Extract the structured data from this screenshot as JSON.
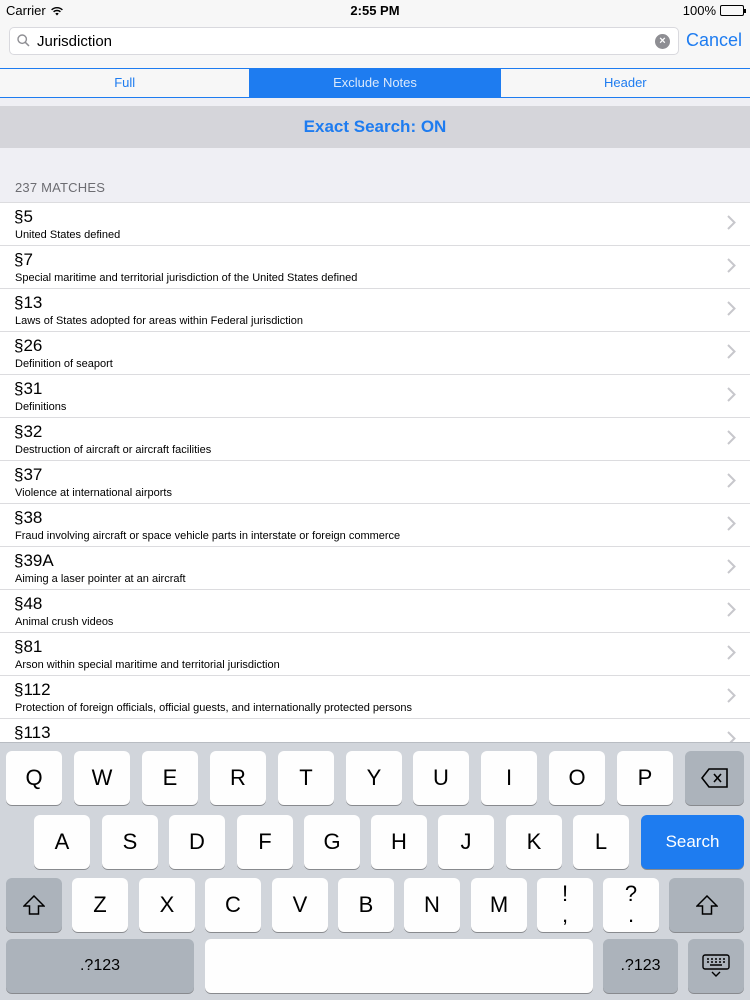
{
  "status": {
    "carrier": "Carrier",
    "time": "2:55 PM",
    "battery": "100%"
  },
  "search": {
    "query": "Jurisdiction",
    "cancel_label": "Cancel"
  },
  "segments": [
    {
      "label": "Full",
      "active": false
    },
    {
      "label": "Exclude Notes",
      "active": true
    },
    {
      "label": "Header",
      "active": false
    }
  ],
  "exact_search": "Exact Search: ON",
  "matches_label": "237 MATCHES",
  "results": [
    {
      "section": "§5",
      "title": "United States defined"
    },
    {
      "section": "§7",
      "title": "Special maritime and territorial jurisdiction of the United States defined"
    },
    {
      "section": "§13",
      "title": "Laws of States adopted for areas within Federal jurisdiction"
    },
    {
      "section": "§26",
      "title": "Definition of seaport"
    },
    {
      "section": "§31",
      "title": "Definitions"
    },
    {
      "section": "§32",
      "title": "Destruction of aircraft or aircraft facilities"
    },
    {
      "section": "§37",
      "title": "Violence at international airports"
    },
    {
      "section": "§38",
      "title": "Fraud involving aircraft or space vehicle parts in interstate or foreign commerce"
    },
    {
      "section": "§39A",
      "title": "Aiming a laser pointer at an aircraft"
    },
    {
      "section": "§48",
      "title": "Animal crush videos"
    },
    {
      "section": "§81",
      "title": "Arson within special maritime and territorial jurisdiction"
    },
    {
      "section": "§112",
      "title": "Protection of foreign officials, official guests, and internationally protected persons"
    },
    {
      "section": "§113",
      "title": ""
    }
  ],
  "keyboard": {
    "row1": [
      "Q",
      "W",
      "E",
      "R",
      "T",
      "Y",
      "U",
      "I",
      "O",
      "P"
    ],
    "row2": [
      "A",
      "S",
      "D",
      "F",
      "G",
      "H",
      "J",
      "K",
      "L"
    ],
    "row3": [
      "Z",
      "X",
      "C",
      "V",
      "B",
      "N",
      "M",
      "!\n,",
      "?\n."
    ],
    "search_label": "Search",
    "numbers_label": ".?123"
  },
  "colors": {
    "accent": "#1e7cf0"
  }
}
